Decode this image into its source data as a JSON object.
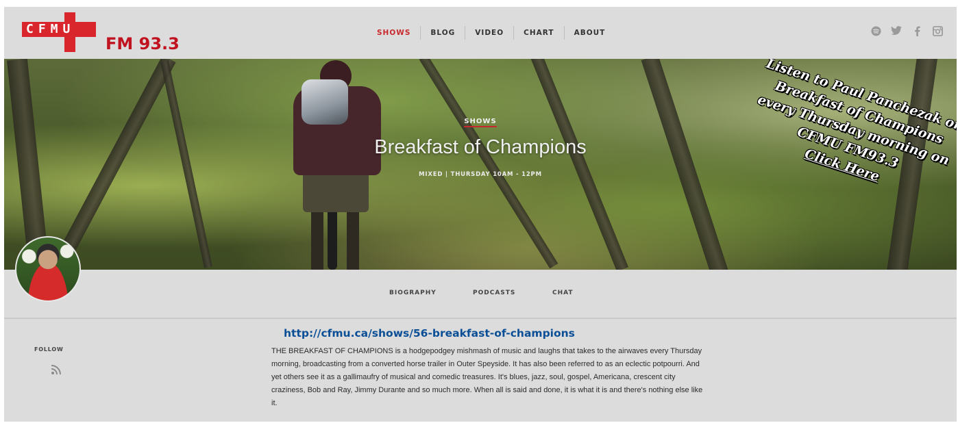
{
  "header": {
    "logo_text": "CFMU",
    "station_label": "FM 93.3",
    "nav": [
      "SHOWS",
      "BLOG",
      "VIDEO",
      "CHART",
      "ABOUT"
    ],
    "social_icons": [
      "spotify-icon",
      "twitter-icon",
      "facebook-icon",
      "instagram-icon"
    ]
  },
  "hero": {
    "category": "SHOWS",
    "title": "Breakfast of Champions",
    "meta": "MIXED  |  THURSDAY 10AM - 12PM"
  },
  "promo": {
    "line1": "Listen to Paul Panchezak on",
    "line2": "Breakfast of Champions",
    "line3": "every Thursday morning on",
    "line4": "CFMU FM93.3",
    "click": "Click Here"
  },
  "tabs": [
    "BIOGRAPHY",
    "PODCASTS",
    "CHAT"
  ],
  "sidebar": {
    "follow_label": "FOLLOW"
  },
  "content": {
    "url": "http://cfmu.ca/shows/56-breakfast-of-champions",
    "description": "THE BREAKFAST OF CHAMPIONS is a hodgepodgey mishmash of music and laughs that takes to the airwaves every Thursday morning, broadcasting from a converted horse trailer in Outer Speyside. It has also been referred to as an eclectic potpourri. And yet others see it as a gallimaufry of musical and comedic treasures. It's blues, jazz, soul, gospel, Americana, crescent city craziness, Bob and Ray, Jimmy Durante and so much more. When all is said and done, it is what it is and there's nothing else like it."
  },
  "colors": {
    "accent": "#c8282d",
    "link": "#0a4f96",
    "background": "#dcdcdc"
  }
}
